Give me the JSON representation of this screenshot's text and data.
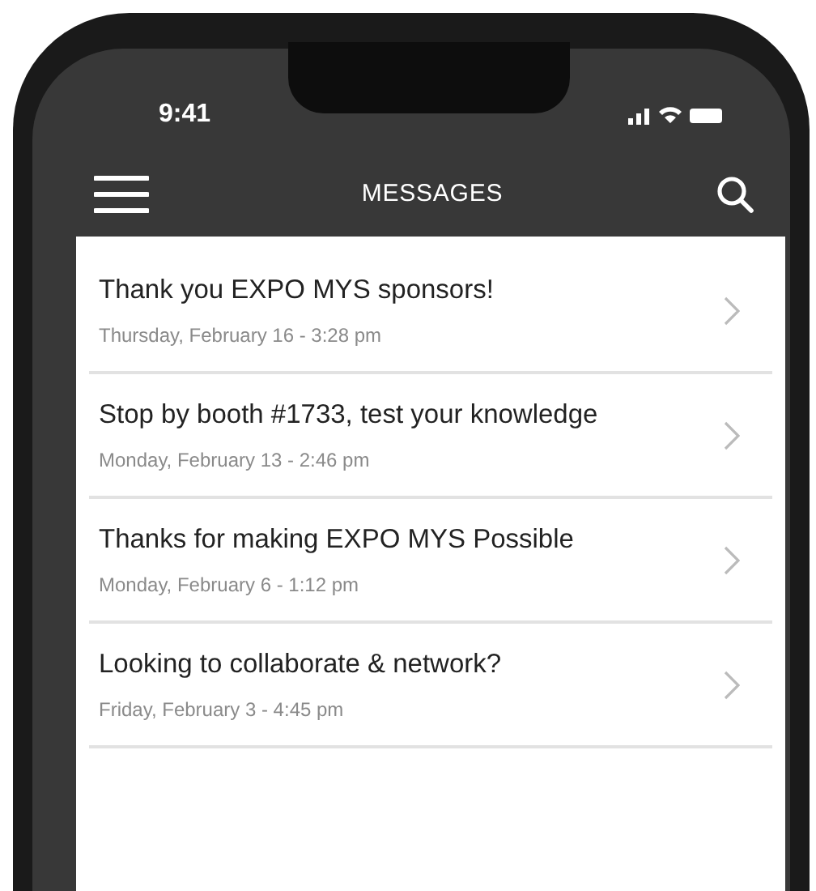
{
  "status_bar": {
    "time": "9:41"
  },
  "header": {
    "title": "MESSAGES"
  },
  "messages": [
    {
      "title": "Thank you EXPO MYS sponsors!",
      "date": "Thursday, February 16 - 3:28 pm"
    },
    {
      "title": "Stop by booth #1733, test your knowledge",
      "date": "Monday, February 13 - 2:46 pm"
    },
    {
      "title": "Thanks for making EXPO MYS Possible",
      "date": "Monday, February 6 - 1:12 pm"
    },
    {
      "title": "Looking to collaborate & network?",
      "date": "Friday, February 3 - 4:45 pm"
    }
  ]
}
